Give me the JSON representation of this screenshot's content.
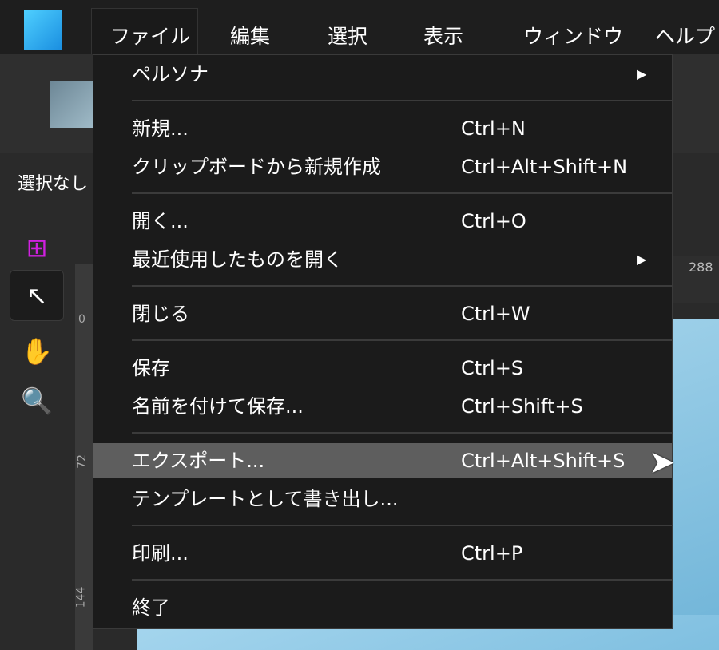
{
  "menubar": {
    "items": [
      "ファイル",
      "編集",
      "選択",
      "表示",
      "ウィンドウ",
      "ヘルプ"
    ]
  },
  "context": {
    "label": "選択なし"
  },
  "rulers": {
    "h_tick": "288",
    "v_ticks": [
      "0",
      "72",
      "144"
    ]
  },
  "menu": {
    "items": [
      {
        "label": "ペルソナ",
        "shortcut": "",
        "submenu": true
      },
      {
        "sep": true
      },
      {
        "label": "新規...",
        "shortcut": "Ctrl+N"
      },
      {
        "label": "クリップボードから新規作成",
        "shortcut": "Ctrl+Alt+Shift+N"
      },
      {
        "sep": true
      },
      {
        "label": "開く...",
        "shortcut": "Ctrl+O"
      },
      {
        "label": "最近使用したものを開く",
        "shortcut": "",
        "submenu": true
      },
      {
        "sep": true
      },
      {
        "label": "閉じる",
        "shortcut": "Ctrl+W"
      },
      {
        "sep": true
      },
      {
        "label": "保存",
        "shortcut": "Ctrl+S"
      },
      {
        "label": "名前を付けて保存...",
        "shortcut": "Ctrl+Shift+S"
      },
      {
        "sep": true
      },
      {
        "label": "エクスポート...",
        "shortcut": "Ctrl+Alt+Shift+S",
        "highlighted": true
      },
      {
        "label": "テンプレートとして書き出し...",
        "shortcut": ""
      },
      {
        "sep": true
      },
      {
        "label": "印刷...",
        "shortcut": "Ctrl+P"
      },
      {
        "sep": true
      },
      {
        "label": "終了",
        "shortcut": ""
      }
    ]
  },
  "icons": {
    "submenu": "▶",
    "cursor": "arrow-pointer"
  }
}
